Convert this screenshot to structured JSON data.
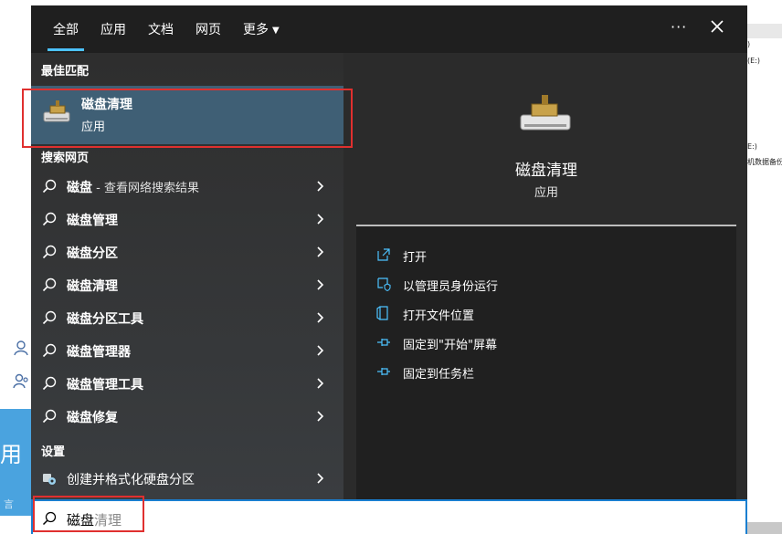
{
  "tabs": [
    {
      "label": "全部",
      "active": true
    },
    {
      "label": "应用",
      "active": false
    },
    {
      "label": "文档",
      "active": false
    },
    {
      "label": "网页",
      "active": false
    },
    {
      "label": "更多",
      "active": false
    }
  ],
  "more_dots": "···",
  "best_match": {
    "section_title": "最佳匹配",
    "name": "磁盘清理",
    "type": "应用",
    "icon": "disk-cleanup-icon"
  },
  "web_section_title": "搜索网页",
  "web_results": [
    {
      "label": "磁盘",
      "suffix": " - 查看网络搜索结果"
    },
    {
      "label": "磁盘管理",
      "suffix": ""
    },
    {
      "label": "磁盘分区",
      "suffix": ""
    },
    {
      "label": "磁盘清理",
      "suffix": ""
    },
    {
      "label": "磁盘分区工具",
      "suffix": ""
    },
    {
      "label": "磁盘管理器",
      "suffix": ""
    },
    {
      "label": "磁盘管理工具",
      "suffix": ""
    },
    {
      "label": "磁盘修复",
      "suffix": ""
    }
  ],
  "settings_section_title": "设置",
  "settings_result": {
    "label": "创建并格式化硬盘分区",
    "icon": "settings-gear-icon"
  },
  "detail": {
    "name": "磁盘清理",
    "type": "应用",
    "actions": [
      {
        "label": "打开",
        "icon": "open-icon"
      },
      {
        "label": "以管理员身份运行",
        "icon": "shield-icon"
      },
      {
        "label": "打开文件位置",
        "icon": "file-location-icon"
      },
      {
        "label": "固定到\"开始\"屏幕",
        "icon": "pin-icon"
      },
      {
        "label": "固定到任务栏",
        "icon": "pin-icon"
      }
    ]
  },
  "search": {
    "typed": "磁盘",
    "suggestion": "清理"
  },
  "background": {
    "left_big_text": "用",
    "left_small_text": "言",
    "right_texts": [
      ") ",
      "(E:)",
      "E:)",
      "机数据备份"
    ]
  },
  "colors": {
    "accent": "#4cc2ff",
    "selection": "#3f5f75",
    "annotation": "#e0302f"
  }
}
